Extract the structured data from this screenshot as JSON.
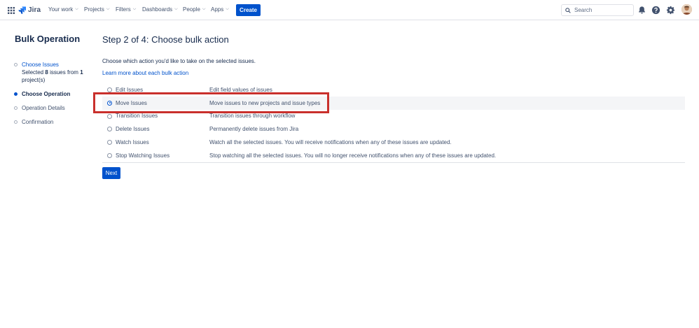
{
  "nav": {
    "logo_text": "Jira",
    "items": [
      {
        "label": "Your work"
      },
      {
        "label": "Projects"
      },
      {
        "label": "Filters"
      },
      {
        "label": "Dashboards"
      },
      {
        "label": "People"
      },
      {
        "label": "Apps"
      }
    ],
    "create_label": "Create",
    "search_placeholder": "Search",
    "accent": "#0052cc"
  },
  "sidebar": {
    "title": "Bulk Operation",
    "steps": [
      {
        "label": "Choose Issues",
        "sub_prefix": "Selected",
        "sub_count": "8",
        "sub_middle": "issues from",
        "sub_projects": "1",
        "sub_suffix": "project(s)"
      },
      {
        "label": "Choose Operation"
      },
      {
        "label": "Operation Details"
      },
      {
        "label": "Confirmation"
      }
    ]
  },
  "main": {
    "title": "Step 2 of 4: Choose bulk action",
    "intro": "Choose which action you'd like to take on the selected issues.",
    "learn_more": "Learn more about each bulk action",
    "operations": [
      {
        "label": "Edit Issues",
        "description": "Edit field values of issues"
      },
      {
        "label": "Move Issues",
        "description": "Move issues to new projects and issue types",
        "selected": true
      },
      {
        "label": "Transition Issues",
        "description": "Transition issues through workflow"
      },
      {
        "label": "Delete Issues",
        "description": "Permanently delete issues from Jira"
      },
      {
        "label": "Watch Issues",
        "description": "Watch all the selected issues. You will receive notifications when any of these issues are updated."
      },
      {
        "label": "Stop Watching Issues",
        "description": "Stop watching all the selected issues. You will no longer receive notifications when any of these issues are updated."
      }
    ],
    "next_label": "Next",
    "highlight_color": "#c9302c"
  }
}
